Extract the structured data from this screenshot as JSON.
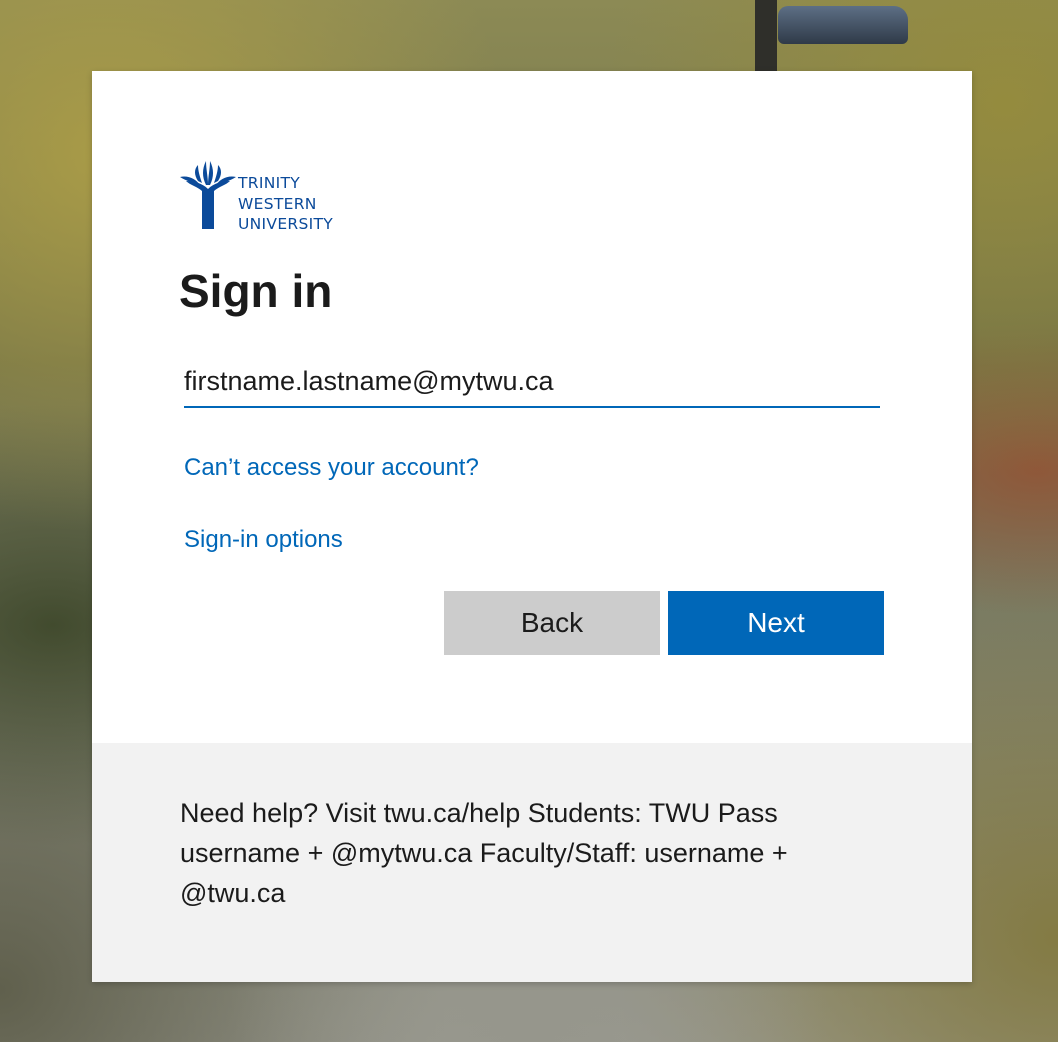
{
  "logo": {
    "line1": "TRINITY",
    "line2": "WESTERN",
    "line3": "UNIVERSITY",
    "brand_color": "#0b4a9a"
  },
  "signin": {
    "title": "Sign in",
    "email_value": "firstname.lastname@mytwu.ca",
    "cant_access_link": "Can’t access your account?",
    "options_link": "Sign-in options",
    "back_label": "Back",
    "next_label": "Next"
  },
  "footer": {
    "help_text": "Need help? Visit twu.ca/help Students: TWU Pass username + @mytwu.ca Faculty/Staff: username + @twu.ca"
  },
  "colors": {
    "accent": "#0067b8",
    "back_button": "#cccccc",
    "footer_bg": "#f2f2f2"
  }
}
